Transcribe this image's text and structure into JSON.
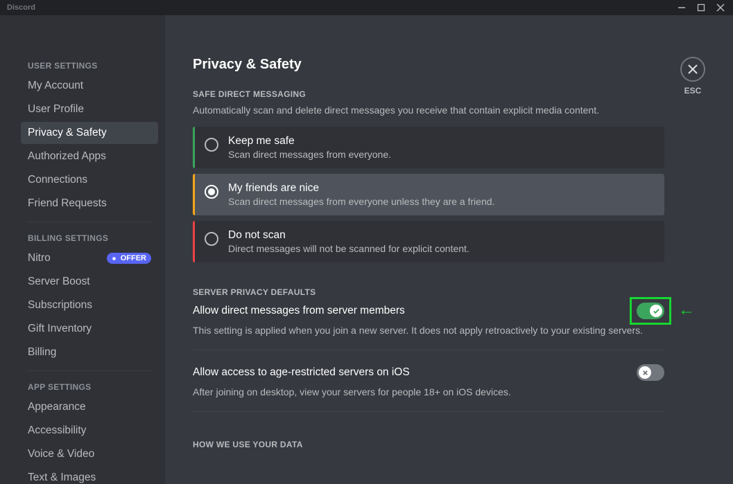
{
  "titlebar": {
    "label": "Discord"
  },
  "sidebar": {
    "headers": {
      "user": "USER SETTINGS",
      "billing": "BILLING SETTINGS",
      "app": "APP SETTINGS"
    },
    "user_items": [
      {
        "label": "My Account"
      },
      {
        "label": "User Profile"
      },
      {
        "label": "Privacy & Safety"
      },
      {
        "label": "Authorized Apps"
      },
      {
        "label": "Connections"
      },
      {
        "label": "Friend Requests"
      }
    ],
    "billing_items": [
      {
        "label": "Nitro",
        "badge": "OFFER"
      },
      {
        "label": "Server Boost"
      },
      {
        "label": "Subscriptions"
      },
      {
        "label": "Gift Inventory"
      },
      {
        "label": "Billing"
      }
    ],
    "app_items": [
      {
        "label": "Appearance"
      },
      {
        "label": "Accessibility"
      },
      {
        "label": "Voice & Video"
      },
      {
        "label": "Text & Images"
      }
    ]
  },
  "main": {
    "title": "Privacy & Safety",
    "close_label": "ESC",
    "safe_dm": {
      "title": "SAFE DIRECT MESSAGING",
      "desc": "Automatically scan and delete direct messages you receive that contain explicit media content.",
      "options": [
        {
          "title": "Keep me safe",
          "sub": "Scan direct messages from everyone."
        },
        {
          "title": "My friends are nice",
          "sub": "Scan direct messages from everyone unless they are a friend."
        },
        {
          "title": "Do not scan",
          "sub": "Direct messages will not be scanned for explicit content."
        }
      ]
    },
    "server_privacy": {
      "title": "SERVER PRIVACY DEFAULTS",
      "allow_dm": {
        "title": "Allow direct messages from server members",
        "sub": "This setting is applied when you join a new server. It does not apply retroactively to your existing servers."
      },
      "age_restricted": {
        "title": "Allow access to age-restricted servers on iOS",
        "sub": "After joining on desktop, view your servers for people 18+ on iOS devices."
      }
    },
    "data_title": "HOW WE USE YOUR DATA"
  }
}
